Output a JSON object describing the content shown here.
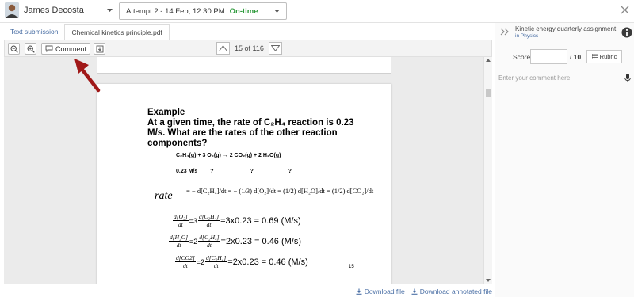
{
  "header": {
    "user_name": "James Decosta",
    "attempt_text": "Attempt 2 - 14 Feb, 12:30 PM",
    "attempt_status": "On-time",
    "status_color": "#2e9a3c"
  },
  "tabs": [
    {
      "label": "Text submission",
      "active": false
    },
    {
      "label": "Chemical kinetics principle.pdf",
      "active": true
    }
  ],
  "toolbar": {
    "comment_label": "Comment",
    "page_info": "15 of 116"
  },
  "document": {
    "example_title": "Example",
    "question_line1": "At a given time, the rate of C₂H₄ reaction is 0.23",
    "question_line2": "M/s.  What are the rates of the other reaction",
    "question_line3": "components?",
    "equation": "C₂H₄(g) + 3 O₂(g) → 2 CO₂(g)  +  2 H₂O(g)",
    "rates_known": "0.23 M/s",
    "rates_unknown": "?",
    "rate_word": "rate",
    "rate_expression": "= − d[C₂H₄]/dt = − (1/3) d[O₂]/dt = (1/2) d[H₂O]/dt = (1/2) d[CO₂]/dt",
    "result_o2": "=3x0.23 = 0.69 (M/s)",
    "result_h2o": "=2x0.23 = 0.46 (M/s)",
    "result_co2": "=2x0.23 = 0.46 (M/s)",
    "page_number": "15"
  },
  "footer": {
    "download_file": "Download file",
    "download_annotated": "Download annotated file"
  },
  "panel": {
    "assignment_title": "Kinetic energy quarterly assignment",
    "assignment_subject": "in Physics",
    "score_label": "Score",
    "score_value": "",
    "score_max": "/ 10",
    "rubric_label": "Rubric",
    "comment_placeholder": "Enter your comment here"
  },
  "colors": {
    "link": "#4a6fa5",
    "annotation_arrow": "#a01818"
  }
}
